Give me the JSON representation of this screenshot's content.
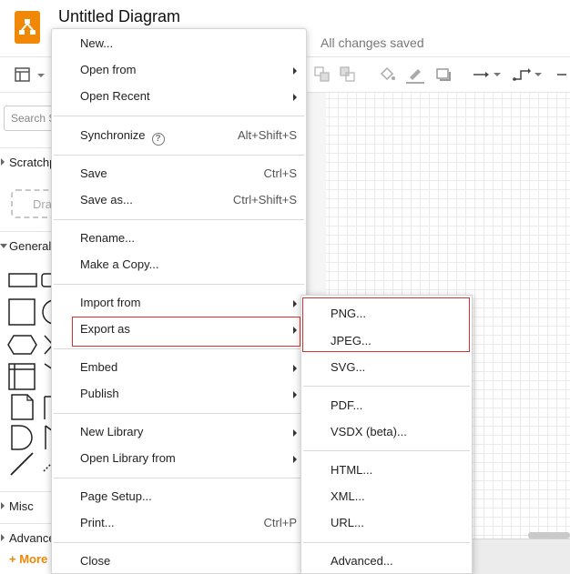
{
  "header": {
    "title": "Untitled Diagram",
    "status": "All changes saved"
  },
  "sidebar": {
    "search_placeholder": "Search Shapes",
    "scratchpad": "Scratchpad",
    "drag_hint": "Drag",
    "sections": {
      "general": "General",
      "misc": "Misc",
      "advanced": "Advanced"
    },
    "more_shapes": "+ More Shapes"
  },
  "file_menu": {
    "items": [
      {
        "label": "New...",
        "shortcut": ""
      },
      {
        "label": "Open from",
        "shortcut": ""
      },
      {
        "label": "Open Recent",
        "shortcut": ""
      },
      {
        "label": "Synchronize",
        "shortcut": "Alt+Shift+S"
      },
      {
        "label": "Save",
        "shortcut": "Ctrl+S"
      },
      {
        "label": "Save as...",
        "shortcut": "Ctrl+Shift+S"
      },
      {
        "label": "Rename...",
        "shortcut": ""
      },
      {
        "label": "Make a Copy...",
        "shortcut": ""
      },
      {
        "label": "Import from",
        "shortcut": ""
      },
      {
        "label": "Export as",
        "shortcut": ""
      },
      {
        "label": "Embed",
        "shortcut": ""
      },
      {
        "label": "Publish",
        "shortcut": ""
      },
      {
        "label": "New Library",
        "shortcut": ""
      },
      {
        "label": "Open Library from",
        "shortcut": ""
      },
      {
        "label": "Page Setup...",
        "shortcut": ""
      },
      {
        "label": "Print...",
        "shortcut": "Ctrl+P"
      },
      {
        "label": "Close",
        "shortcut": ""
      }
    ]
  },
  "export_submenu": {
    "items": [
      {
        "label": "PNG..."
      },
      {
        "label": "JPEG..."
      },
      {
        "label": "SVG..."
      },
      {
        "label": "PDF..."
      },
      {
        "label": "VSDX (beta)..."
      },
      {
        "label": "HTML..."
      },
      {
        "label": "XML..."
      },
      {
        "label": "URL..."
      },
      {
        "label": "Advanced..."
      }
    ]
  },
  "colors": {
    "brand": "#f08705",
    "highlight_border": "#cc3333"
  }
}
